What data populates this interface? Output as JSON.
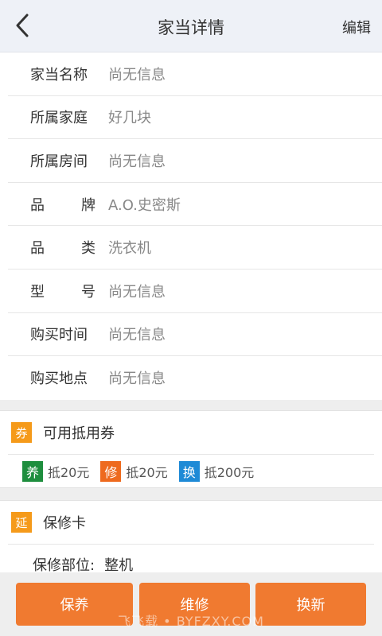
{
  "header": {
    "title": "家当详情",
    "edit_label": "编辑",
    "back_icon": "chevron-left-icon"
  },
  "info": [
    {
      "label": "家当名称",
      "value": "尚无信息"
    },
    {
      "label": "所属家庭",
      "value": "好几块"
    },
    {
      "label": "所属房间",
      "value": "尚无信息"
    },
    {
      "label": "品牌",
      "value": "A.O.史密斯"
    },
    {
      "label": "品类",
      "value": "洗衣机"
    },
    {
      "label": "型号",
      "value": "尚无信息"
    },
    {
      "label": "购买时间",
      "value": "尚无信息"
    },
    {
      "label": "购买地点",
      "value": "尚无信息"
    }
  ],
  "coupons": {
    "icon_text": "券",
    "title": "可用抵用券",
    "items": [
      {
        "badge": "养",
        "text": "抵20元",
        "color": "#1e8e3e"
      },
      {
        "badge": "修",
        "text": "抵20元",
        "color": "#ee6a1e"
      },
      {
        "badge": "换",
        "text": "抵200元",
        "color": "#1e8ad6"
      }
    ]
  },
  "warranty": {
    "icon_text": "延",
    "title": "保修卡",
    "part_label": "保修部位:",
    "part_value": "整机"
  },
  "actions": {
    "maintain": "保养",
    "repair": "维修",
    "replace": "换新"
  },
  "watermark": "飞飞载 • BYFZXY.COM",
  "colors": {
    "accent": "#f07a30",
    "section_icon": "#f59a1a"
  }
}
